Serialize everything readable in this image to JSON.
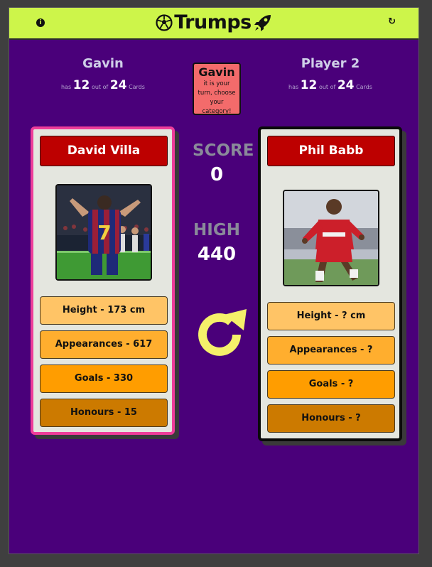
{
  "app": {
    "title": "Trumps"
  },
  "topbar": {
    "info_icon": "info-icon",
    "refresh_icon": "refresh-icon",
    "ball_icon": "football-icon",
    "rocket_icon": "rocket-icon"
  },
  "player1": {
    "name": "Gavin",
    "has": "has",
    "count": "12",
    "out_of": "out of",
    "total": "24",
    "cards": "Cards"
  },
  "player2": {
    "name": "Player 2",
    "has": "has",
    "count": "12",
    "out_of": "out of",
    "total": "24",
    "cards": "Cards"
  },
  "turn": {
    "name": "Gavin",
    "message": "it is your turn, choose your category!"
  },
  "card_left": {
    "name": "David Villa",
    "stats": [
      "Height - 173 cm",
      "Appearances - 617",
      "Goals - 330",
      "Honours - 15"
    ]
  },
  "card_right": {
    "name": "Phil Babb",
    "stats": [
      "Height - ? cm",
      "Appearances - ?",
      "Goals - ?",
      "Honours - ?"
    ]
  },
  "score": {
    "label": "SCORE",
    "value": "0"
  },
  "high": {
    "label": "HIGH",
    "value": "440"
  },
  "colors": {
    "background": "#4a007a",
    "topbar": "#cdf54a",
    "card_name": "#bd0000",
    "left_border": "#ee3d9a",
    "next_arrow": "#f5f06a"
  }
}
